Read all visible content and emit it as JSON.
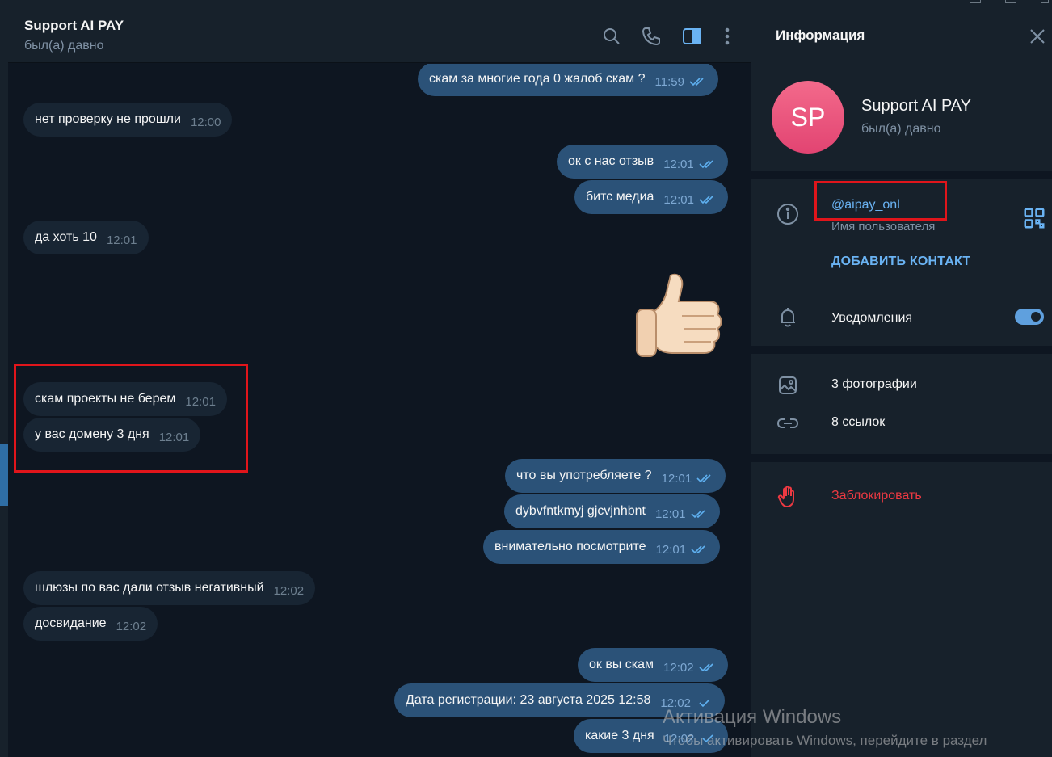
{
  "header": {
    "title": "Support AI PAY",
    "status": "был(а) давно"
  },
  "header_icons": [
    "search-icon",
    "phone-icon",
    "sidebar-toggle-icon",
    "more-vertical-icon"
  ],
  "messages": [
    {
      "dir": "out",
      "text": "скам за многие  года 0 жалоб скам ?",
      "time": "11:59",
      "ticks": "double"
    },
    {
      "dir": "in",
      "text": "нет проверку не прошли",
      "time": "12:00"
    },
    {
      "dir": "out",
      "text": "ок с нас отзыв",
      "time": "12:01",
      "ticks": "double"
    },
    {
      "dir": "out",
      "text": "битс медиа",
      "time": "12:01",
      "ticks": "double"
    },
    {
      "dir": "in",
      "text": "да хоть 10",
      "time": "12:01"
    },
    {
      "dir": "in",
      "text": "скам проекты не берем",
      "time": "12:01"
    },
    {
      "dir": "in",
      "text": "у вас домену 3 дня",
      "time": "12:01"
    },
    {
      "dir": "out",
      "text": "что вы употребляете ?",
      "time": "12:01",
      "ticks": "double"
    },
    {
      "dir": "out",
      "text": "dybvfntkmyj gjcvjnhbnt",
      "time": "12:01",
      "ticks": "double"
    },
    {
      "dir": "out",
      "text": "внимательно посмотрите",
      "time": "12:01",
      "ticks": "double"
    },
    {
      "dir": "in",
      "text": "шлюзы по вас дали отзыв негативный",
      "time": "12:02"
    },
    {
      "dir": "in",
      "text": "досвидание",
      "time": "12:02"
    },
    {
      "dir": "out",
      "text": "ок вы скам",
      "time": "12:02",
      "ticks": "double"
    },
    {
      "dir": "out",
      "text": "Дата регистрации: 23 августа 2025 12:58",
      "time": "12:02",
      "ticks": "single"
    },
    {
      "dir": "out",
      "text": "какие 3 дня",
      "time": "12:02",
      "ticks": "single"
    }
  ],
  "sticker": "thumbs-up",
  "info_panel": {
    "title": "Информация",
    "avatar_initials": "SP",
    "name": "Support AI PAY",
    "status": "был(а) давно",
    "username": "@aipay_onl",
    "username_label": "Имя пользователя",
    "add_contact": "ДОБАВИТЬ КОНТАКТ",
    "notifications": "Уведомления",
    "notifications_on": true,
    "photos": "3 фотографии",
    "links": "8 ссылок",
    "block": "Заблокировать"
  },
  "watermark": {
    "title": "Активация Windows",
    "subtitle": "Чтобы активировать Windows, перейдите в раздел"
  },
  "colors": {
    "bg": "#0e1621",
    "panel": "#17212b",
    "incoming": "#182533",
    "outgoing": "#2b5278",
    "accent": "#6ab3f3",
    "danger": "#ec3942",
    "highlight": "#e0151b"
  }
}
